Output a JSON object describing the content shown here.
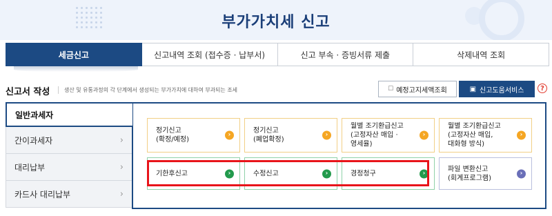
{
  "header": {
    "title": "부가가치세 신고"
  },
  "tabs": [
    {
      "label": "세금신고"
    },
    {
      "label": "신고내역 조회 (접수증 · 납부서)"
    },
    {
      "label": "신고 부속 · 증빙서류 제출"
    },
    {
      "label": "삭제내역 조회"
    }
  ],
  "section": {
    "title": "신고서 작성",
    "description": "생산 및 유통과정의 각 단계에서 생성되는 부가가치에 대하여 부과되는 조세",
    "btn_estimate": "예정고지세액조회",
    "btn_help_service": "신고도움서비스",
    "help_mark": "?"
  },
  "sidebar": {
    "items": [
      {
        "label": "일반과세자"
      },
      {
        "label": "간이과세자"
      },
      {
        "label": "대리납부"
      },
      {
        "label": "카드사 대리납부"
      }
    ]
  },
  "cards": {
    "row1": [
      {
        "line1": "정기신고",
        "line2": "(확정/예정)"
      },
      {
        "line1": "정기신고",
        "line2": "(폐업확정)"
      },
      {
        "line1": "월별 조기환급신고",
        "line2": "(고정자산 매입 ·",
        "line3": "영세율)"
      },
      {
        "line1": "월별 조기환급신고",
        "line2": "(고정자산 매입,",
        "line3": "대화형 방식)"
      }
    ],
    "row2": [
      {
        "line1": "기한후신고"
      },
      {
        "line1": "수정신고"
      },
      {
        "line1": "경정청구"
      },
      {
        "line1": "파일 변환신고",
        "line2": "(회계프로그램)"
      }
    ]
  },
  "glyphs": {
    "chevron": "›",
    "arrow": "›",
    "doc_icon": "☐",
    "book_icon": "▣"
  },
  "colors": {
    "primary": "#1c4a83",
    "orange": "#f5a623",
    "green": "#229a4c",
    "purple": "#6a6fb8",
    "highlight": "#e8141a"
  }
}
